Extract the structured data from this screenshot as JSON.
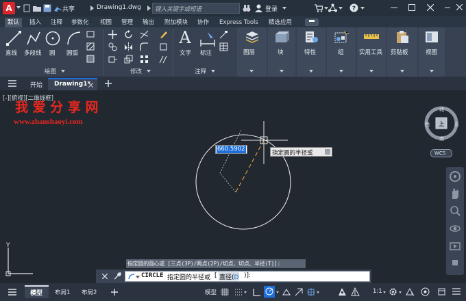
{
  "titlebar": {
    "app_logo": "A",
    "share_label": "共享",
    "doc_title": "Drawing1.dwg",
    "search_placeholder": "键入关键字或短语",
    "login_label": "登录"
  },
  "ribbon_tabs": [
    "默认",
    "插入",
    "注释",
    "参数化",
    "视图",
    "管理",
    "输出",
    "附加模块",
    "协作",
    "Express Tools",
    "精选应用"
  ],
  "ribbon": {
    "draw_buttons": {
      "line": "直线",
      "polyline": "多段线",
      "circle": "圆",
      "arc": "圆弧"
    },
    "text_label": "文字",
    "dim_label": "标注",
    "panels": {
      "draw": "绘图",
      "modify": "修改",
      "annotation": "注释"
    },
    "big_buttons": [
      "图层",
      "块",
      "特性",
      "组",
      "实用工具",
      "剪贴板",
      "视图"
    ]
  },
  "doc_tabs": {
    "start": "开始",
    "drawing": "Drawing1*"
  },
  "viewport": {
    "view_label": "[-][俯视][二维线框]",
    "watermark_title": "我 爱 分 享 网",
    "watermark_url": "www.zhanshaoyi.com",
    "dyn_input_value": "660.5902",
    "tooltip": "指定圆的半径或",
    "viewcube": {
      "north": "北",
      "south": "南",
      "west": "西",
      "east": "东",
      "top": "上",
      "wcs": "WCS"
    },
    "ucs_y": "Y"
  },
  "command": {
    "history": "指定圆的圆心或 [三点(3P)/两点(2P)/切点、切点、半径(T)]:",
    "command_name": "CIRCLE",
    "prompt": "指定圆的半径或",
    "option_prefix": "[",
    "option": "直径(",
    "option_key": "D",
    "option_suffix": ")]:"
  },
  "status": {
    "model_tab": "模型",
    "layout1": "布局1",
    "layout2": "布局2",
    "model_label": "模型",
    "scale": "1:1"
  },
  "colors": {
    "accent": "#1e6fd9",
    "logo": "#d9252b",
    "watermark": "#e8271f"
  }
}
